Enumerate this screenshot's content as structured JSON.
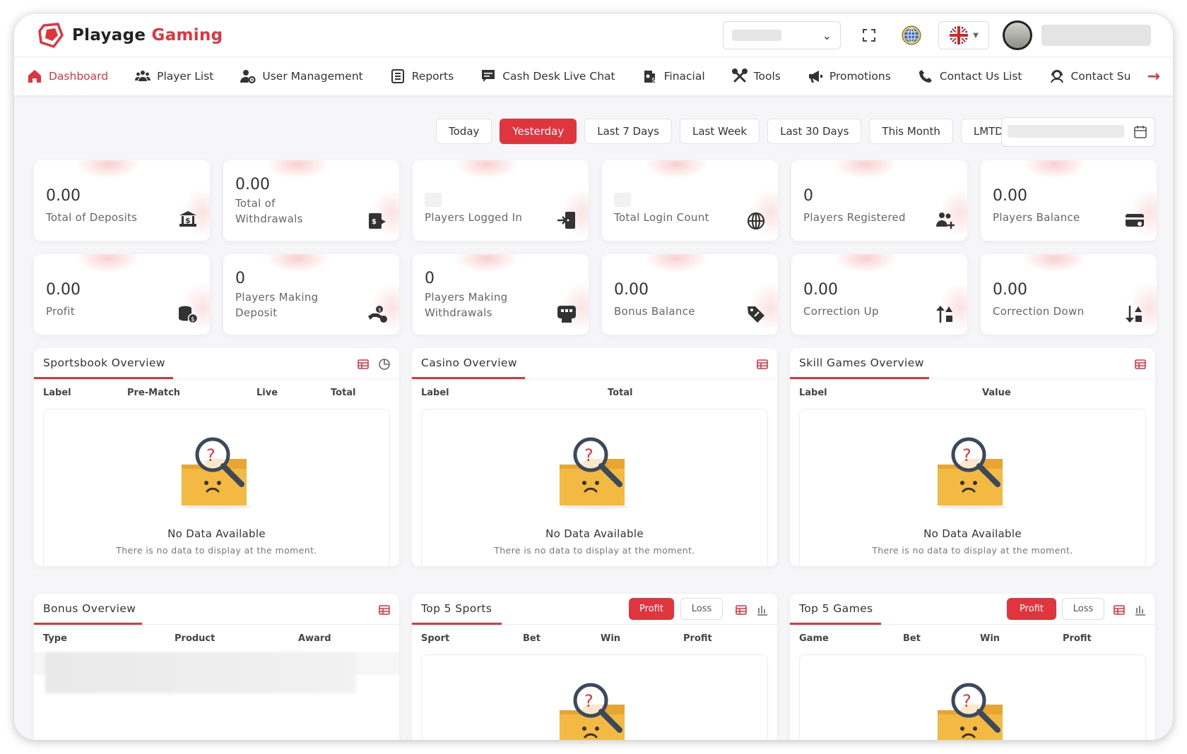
{
  "brand": {
    "name": "Playage",
    "accent": "Gaming"
  },
  "nav": [
    {
      "label": "Dashboard",
      "icon": "home-icon",
      "active": true
    },
    {
      "label": "Player List",
      "icon": "users-icon"
    },
    {
      "label": "User Management",
      "icon": "user-gear-icon"
    },
    {
      "label": "Reports",
      "icon": "report-icon"
    },
    {
      "label": "Cash Desk Live Chat",
      "icon": "chat-icon"
    },
    {
      "label": "Finacial",
      "icon": "finance-icon"
    },
    {
      "label": "Tools",
      "icon": "tools-icon"
    },
    {
      "label": "Promotions",
      "icon": "megaphone-icon"
    },
    {
      "label": "Contact Us List",
      "icon": "phone-icon"
    },
    {
      "label": "Contact Su",
      "icon": "support-icon"
    }
  ],
  "filters": [
    "Today",
    "Yesterday",
    "Last 7 Days",
    "Last Week",
    "Last 30 Days",
    "This Month",
    "LMTD"
  ],
  "active_filter": "Yesterday",
  "stats_row1": [
    {
      "value": "0.00",
      "label": "Total of Deposits"
    },
    {
      "value": "0.00",
      "label": "Total of Withdrawals"
    },
    {
      "value": "",
      "label": "Players Logged In"
    },
    {
      "value": "",
      "label": "Total Login Count"
    },
    {
      "value": "0",
      "label": "Players Registered"
    },
    {
      "value": "0.00",
      "label": "Players Balance"
    }
  ],
  "stats_row2": [
    {
      "value": "0.00",
      "label": "Profit"
    },
    {
      "value": "0",
      "label": "Players Making Deposit"
    },
    {
      "value": "0",
      "label": "Players Making Withdrawals"
    },
    {
      "value": "0.00",
      "label": "Bonus Balance"
    },
    {
      "value": "0.00",
      "label": "Correction Up"
    },
    {
      "value": "0.00",
      "label": "Correction Down"
    }
  ],
  "sportsbook": {
    "title": "Sportsbook Overview",
    "columns": [
      "Label",
      "Pre-Match",
      "Live",
      "Total"
    ]
  },
  "casino": {
    "title": "Casino Overview",
    "columns": [
      "Label",
      "Total"
    ]
  },
  "skill": {
    "title": "Skill Games Overview",
    "columns": [
      "Label",
      "Value"
    ]
  },
  "bonus": {
    "title": "Bonus Overview",
    "columns": [
      "Type",
      "Product",
      "Award"
    ]
  },
  "top_sports": {
    "title": "Top 5 Sports",
    "columns": [
      "Sport",
      "Bet",
      "Win",
      "Profit"
    ],
    "profit": "Profit",
    "loss": "Loss"
  },
  "top_games": {
    "title": "Top 5 Games",
    "columns": [
      "Game",
      "Bet",
      "Win",
      "Profit"
    ],
    "profit": "Profit",
    "loss": "Loss"
  },
  "empty": {
    "title": "No Data Available",
    "subtitle": "There is no data to display at the moment."
  },
  "colors": {
    "accent": "#e0353f",
    "folder": "#f3b73f",
    "magnifier": "#3a4a5c"
  }
}
